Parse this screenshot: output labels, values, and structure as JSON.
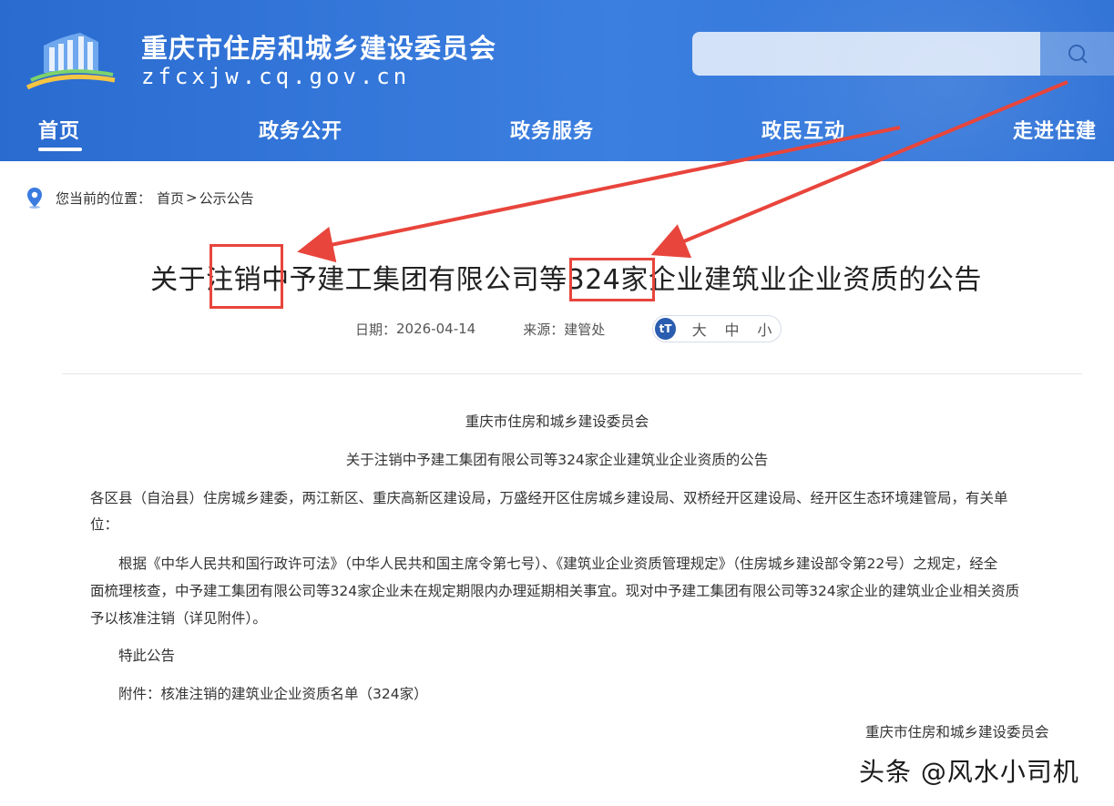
{
  "header": {
    "site_title": "重庆市住房和城乡建设委员会",
    "site_domain": "zfcxjw.cq.gov.cn",
    "search_placeholder": "",
    "nav": [
      {
        "label": "首页"
      },
      {
        "label": "政务公开"
      },
      {
        "label": "政务服务"
      },
      {
        "label": "政民互动"
      },
      {
        "label": "走进住建"
      }
    ]
  },
  "breadcrumb": {
    "prefix": "您当前的位置：",
    "home": "首页",
    "separator": ">",
    "current": "公示公告"
  },
  "article": {
    "title": "关于注销中予建工集团有限公司等324家企业建筑业企业资质的公告",
    "date_label": "日期：",
    "date": "2026-04-14",
    "source_label": "来源：",
    "source": "建管处",
    "font_icon": "tT",
    "font_sizes": [
      "大",
      "中",
      "小"
    ],
    "body": {
      "org": "重庆市住房和城乡建设委员会",
      "subtitle": "关于注销中予建工集团有限公司等324家企业建筑业企业资质的公告",
      "salutation_1": "各区县（自治县）住房城乡建委，两江新区、重庆高新区建设局，万盛经开区住房城乡建设局、双桥经开区建设局、经开区生态环境建管局，有关单",
      "salutation_2": "位：",
      "para_1": "根据《中华人民共和国行政许可法》（中华人民共和国主席令第七号）、《建筑业企业资质管理规定》（住房城乡建设部令第22号）之规定，经全",
      "para_2": "面梳理核查，中予建工集团有限公司等324家企业未在规定期限内办理延期相关事宜。现对中予建工集团有限公司等324家企业的建筑业企业相关资质",
      "para_3": "予以核准注销（详见附件）。",
      "notice": "特此公告",
      "attachment": "附件：核准注销的建筑业企业资质名单（324家）",
      "signature": "重庆市住房和城乡建设委员会"
    }
  },
  "watermark": "头条 @风水小司机",
  "colors": {
    "header_blue": "#2f72d6",
    "annotation_red": "#e8453c",
    "icon_blue": "#2a5db0"
  }
}
